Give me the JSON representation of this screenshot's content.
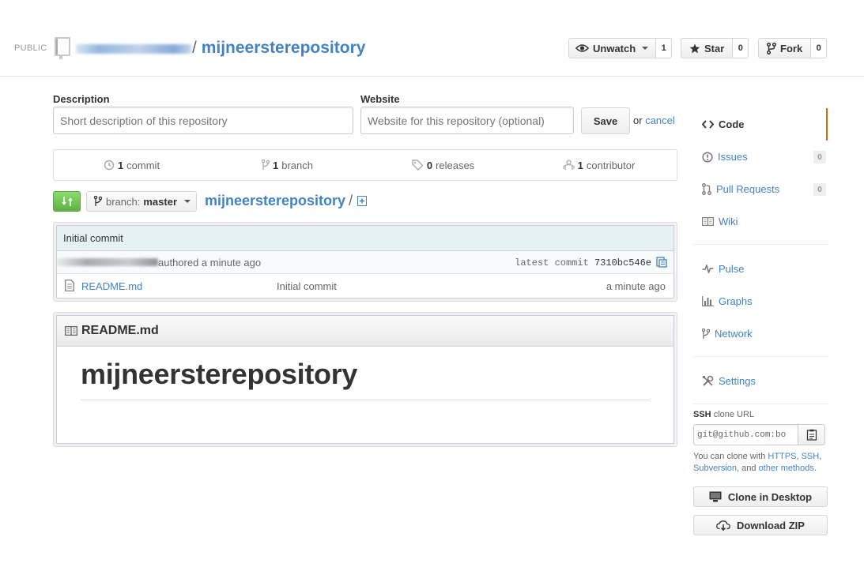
{
  "header": {
    "visibility": "PUBLIC",
    "slash": "/",
    "repo_name": "mijneersterepository",
    "watch": {
      "label": "Unwatch",
      "count": "1"
    },
    "star": {
      "label": "Star",
      "count": "0"
    },
    "fork": {
      "label": "Fork",
      "count": "0"
    }
  },
  "edit": {
    "description_label": "Description",
    "description_placeholder": "Short description of this repository",
    "website_label": "Website",
    "website_placeholder": "Website for this repository (optional)",
    "save_label": "Save",
    "or_text": "or",
    "cancel_label": "cancel"
  },
  "summary": {
    "commits": {
      "num": "1",
      "label": "commit"
    },
    "branches": {
      "num": "1",
      "label": "branch"
    },
    "releases": {
      "num": "0",
      "label": "releases"
    },
    "contributors": {
      "num": "1",
      "label": "contributor"
    }
  },
  "nav": {
    "branch_prefix": "branch:",
    "branch_name": "master",
    "breadcrumb_repo": "mijneersterepository",
    "breadcrumb_sep": "/"
  },
  "commit": {
    "message": "Initial commit",
    "authored": "authored a minute ago",
    "latest_label": "latest commit",
    "sha": "7310bc546e"
  },
  "files": [
    {
      "name": "README.md",
      "message": "Initial commit",
      "age": "a minute ago"
    }
  ],
  "readme": {
    "filename": "README.md",
    "heading": "mijneersterepository"
  },
  "sidebar": {
    "code": "Code",
    "issues": {
      "label": "Issues",
      "count": "0"
    },
    "pulls": {
      "label": "Pull Requests",
      "count": "0"
    },
    "wiki": "Wiki",
    "pulse": "Pulse",
    "graphs": "Graphs",
    "network": "Network",
    "settings": "Settings"
  },
  "clone": {
    "protocol": "SSH",
    "label_rest": "clone URL",
    "url": "git@github.com:bo",
    "help_prefix": "You can clone with",
    "https": "HTTPS",
    "ssh": "SSH",
    "subversion": "Subversion",
    "and": ", and",
    "other": "other methods",
    "period": ".",
    "desktop_label": "Clone in Desktop",
    "zip_label": "Download ZIP"
  },
  "colors": {
    "link": "#4183c4",
    "accent_orange": "#d26911",
    "compare_green": "#60b044"
  }
}
